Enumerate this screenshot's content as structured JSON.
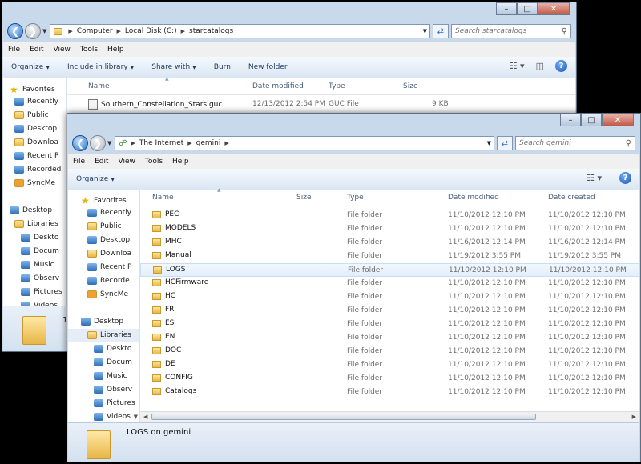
{
  "back_window": {
    "address": [
      "Computer",
      "Local Disk (C:)",
      "starcatalogs"
    ],
    "search_placeholder": "Search starcatalogs",
    "menu": [
      "File",
      "Edit",
      "View",
      "Tools",
      "Help"
    ],
    "commands": [
      {
        "label": "Organize",
        "dropdown": true
      },
      {
        "label": "Include in library",
        "dropdown": true
      },
      {
        "label": "Share with",
        "dropdown": true
      },
      {
        "label": "Burn",
        "dropdown": false
      },
      {
        "label": "New folder",
        "dropdown": false
      }
    ],
    "columns": [
      "Name",
      "Date modified",
      "Type",
      "Size"
    ],
    "files": [
      {
        "name": "Southern_Constellation_Stars.guc",
        "modified": "12/13/2012 2:54 PM",
        "type": "GUC File",
        "size": "9 KB"
      }
    ],
    "nav": [
      "Favorites",
      "Recently",
      "Public",
      "Desktop",
      "Downloa",
      "Recent P",
      "Recorded",
      "SyncMe",
      "Desktop",
      "Libraries",
      "Deskto",
      "Docum",
      "Music",
      "Observ",
      "Pictures",
      "Videos"
    ],
    "details_count": "1"
  },
  "front_window": {
    "address": [
      "The Internet",
      "gemini"
    ],
    "search_placeholder": "Search gemini",
    "menu": [
      "File",
      "Edit",
      "View",
      "Tools",
      "Help"
    ],
    "commands": [
      {
        "label": "Organize",
        "dropdown": true
      }
    ],
    "columns": [
      "Name",
      "Size",
      "Type",
      "Date modified",
      "Date created"
    ],
    "folders": [
      {
        "name": "PEC",
        "type": "File folder",
        "modified": "11/10/2012 12:10 PM",
        "created": "11/10/2012 12:10 PM"
      },
      {
        "name": "MODELS",
        "type": "File folder",
        "modified": "11/10/2012 12:10 PM",
        "created": "11/10/2012 12:10 PM"
      },
      {
        "name": "MHC",
        "type": "File folder",
        "modified": "11/16/2012 12:14 PM",
        "created": "11/16/2012 12:14 PM"
      },
      {
        "name": "Manual",
        "type": "File folder",
        "modified": "11/19/2012 3:55 PM",
        "created": "11/19/2012 3:55 PM"
      },
      {
        "name": "LOGS",
        "type": "File folder",
        "modified": "11/10/2012 12:10 PM",
        "created": "11/10/2012 12:10 PM"
      },
      {
        "name": "HCFirmware",
        "type": "File folder",
        "modified": "11/10/2012 12:10 PM",
        "created": "11/10/2012 12:10 PM"
      },
      {
        "name": "HC",
        "type": "File folder",
        "modified": "11/10/2012 12:10 PM",
        "created": "11/10/2012 12:10 PM"
      },
      {
        "name": "FR",
        "type": "File folder",
        "modified": "11/10/2012 12:10 PM",
        "created": "11/10/2012 12:10 PM"
      },
      {
        "name": "ES",
        "type": "File folder",
        "modified": "11/10/2012 12:10 PM",
        "created": "11/10/2012 12:10 PM"
      },
      {
        "name": "EN",
        "type": "File folder",
        "modified": "11/10/2012 12:10 PM",
        "created": "11/10/2012 12:10 PM"
      },
      {
        "name": "DOC",
        "type": "File folder",
        "modified": "11/10/2012 12:10 PM",
        "created": "11/10/2012 12:10 PM"
      },
      {
        "name": "DE",
        "type": "File folder",
        "modified": "11/10/2012 12:10 PM",
        "created": "11/10/2012 12:10 PM"
      },
      {
        "name": "CONFIG",
        "type": "File folder",
        "modified": "11/10/2012 12:10 PM",
        "created": "11/10/2012 12:10 PM"
      },
      {
        "name": "Catalogs",
        "type": "File folder",
        "modified": "11/10/2012 12:10 PM",
        "created": "11/10/2012 12:10 PM"
      }
    ],
    "nav": [
      "Favorites",
      "Recently",
      "Public",
      "Desktop",
      "Downloa",
      "Recent P",
      "Recorde",
      "SyncMe",
      "Desktop",
      "Libraries",
      "Deskto",
      "Docum",
      "Music",
      "Observ",
      "Pictures",
      "Videos"
    ],
    "selected_item": "LOGS on gemini"
  }
}
